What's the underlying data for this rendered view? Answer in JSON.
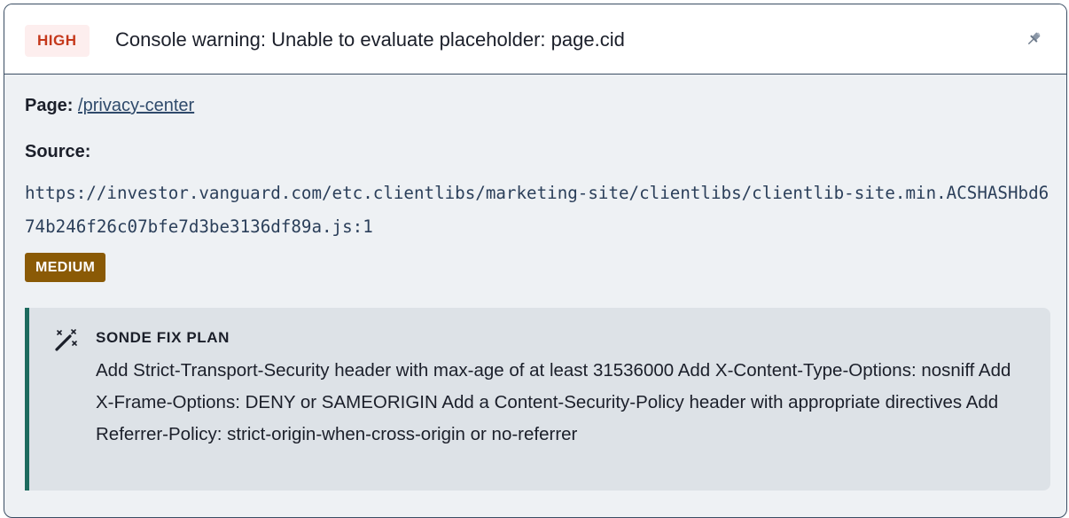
{
  "issue": {
    "severity": "HIGH",
    "title": "Console warning: Unable to evaluate placeholder: page.cid",
    "pin_icon": "pin-icon"
  },
  "details": {
    "page_label": "Page:",
    "page_link": "/privacy-center",
    "source_label": "Source:",
    "source_url": "https://investor.vanguard.com/etc.clientlibs/marketing-site/clientlibs/clientlib-site.min.ACSHASHbd674b246f26c07bfe7d3be3136df89a.js:1",
    "impact": "MEDIUM"
  },
  "fix_plan": {
    "icon": "magic-wand-icon",
    "title": "SONDE FIX PLAN",
    "text": "Add Strict-Transport-Security header with max-age of at least 31536000 Add X-Content-Type-Options: nosniff Add X-Frame-Options: DENY or SAMEORIGIN Add a Content-Security-Policy header with appropriate directives Add Referrer-Policy: strict-origin-when-cross-origin or no-referrer"
  },
  "colors": {
    "high_text": "#c5381b",
    "high_bg": "#fdeeee",
    "medium_bg": "#8a5a06",
    "fix_accent": "#1d6b5e",
    "border": "#3a4d63"
  }
}
